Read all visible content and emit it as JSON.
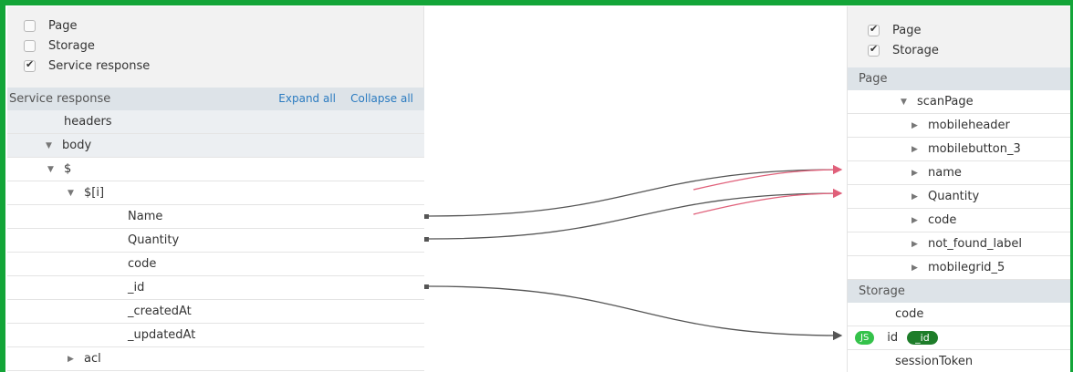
{
  "left": {
    "checks": [
      {
        "label": "Page",
        "checked": false
      },
      {
        "label": "Storage",
        "checked": false
      },
      {
        "label": "Service response",
        "checked": true
      }
    ],
    "section_title": "Service response",
    "expand_all": "Expand all",
    "collapse_all": "Collapse all",
    "tree": [
      {
        "label": "headers",
        "arrow": "",
        "indent": 0
      },
      {
        "label": "body",
        "arrow": "▼",
        "indent": 0
      },
      {
        "label": "$",
        "arrow": "▼",
        "indent": 1
      },
      {
        "label": "$[i]",
        "arrow": "▼",
        "indent": 2
      },
      {
        "label": "Name",
        "arrow": "",
        "indent": 3
      },
      {
        "label": "Quantity",
        "arrow": "",
        "indent": 3
      },
      {
        "label": "code",
        "arrow": "",
        "indent": 3
      },
      {
        "label": "_id",
        "arrow": "",
        "indent": 3
      },
      {
        "label": "_createdAt",
        "arrow": "",
        "indent": 3
      },
      {
        "label": "_updatedAt",
        "arrow": "",
        "indent": 3
      },
      {
        "label": "acl",
        "arrow": "▶",
        "indent": 2
      }
    ]
  },
  "right": {
    "checks": [
      {
        "label": "Page",
        "checked": true
      },
      {
        "label": "Storage",
        "checked": true
      }
    ],
    "page_title": "Page",
    "page_tree": [
      {
        "label": "scanPage",
        "arrow": "▼",
        "indent": 0
      },
      {
        "label": "mobileheader",
        "arrow": "▶",
        "indent": 1
      },
      {
        "label": "mobilebutton_3",
        "arrow": "▶",
        "indent": 1
      },
      {
        "label": "name",
        "arrow": "▶",
        "indent": 1
      },
      {
        "label": "Quantity",
        "arrow": "▶",
        "indent": 1
      },
      {
        "label": "code",
        "arrow": "▶",
        "indent": 1
      },
      {
        "label": "not_found_label",
        "arrow": "▶",
        "indent": 1
      },
      {
        "label": "mobilegrid_5",
        "arrow": "▶",
        "indent": 1
      }
    ],
    "storage_title": "Storage",
    "storage": [
      {
        "label": "code"
      },
      {
        "label": "id",
        "badge": "JS",
        "pill": "_id"
      },
      {
        "label": "sessionToken"
      }
    ]
  },
  "colors": {
    "frame": "#13a538",
    "link_dark": "#555555",
    "link_pink": "#e0607a"
  }
}
